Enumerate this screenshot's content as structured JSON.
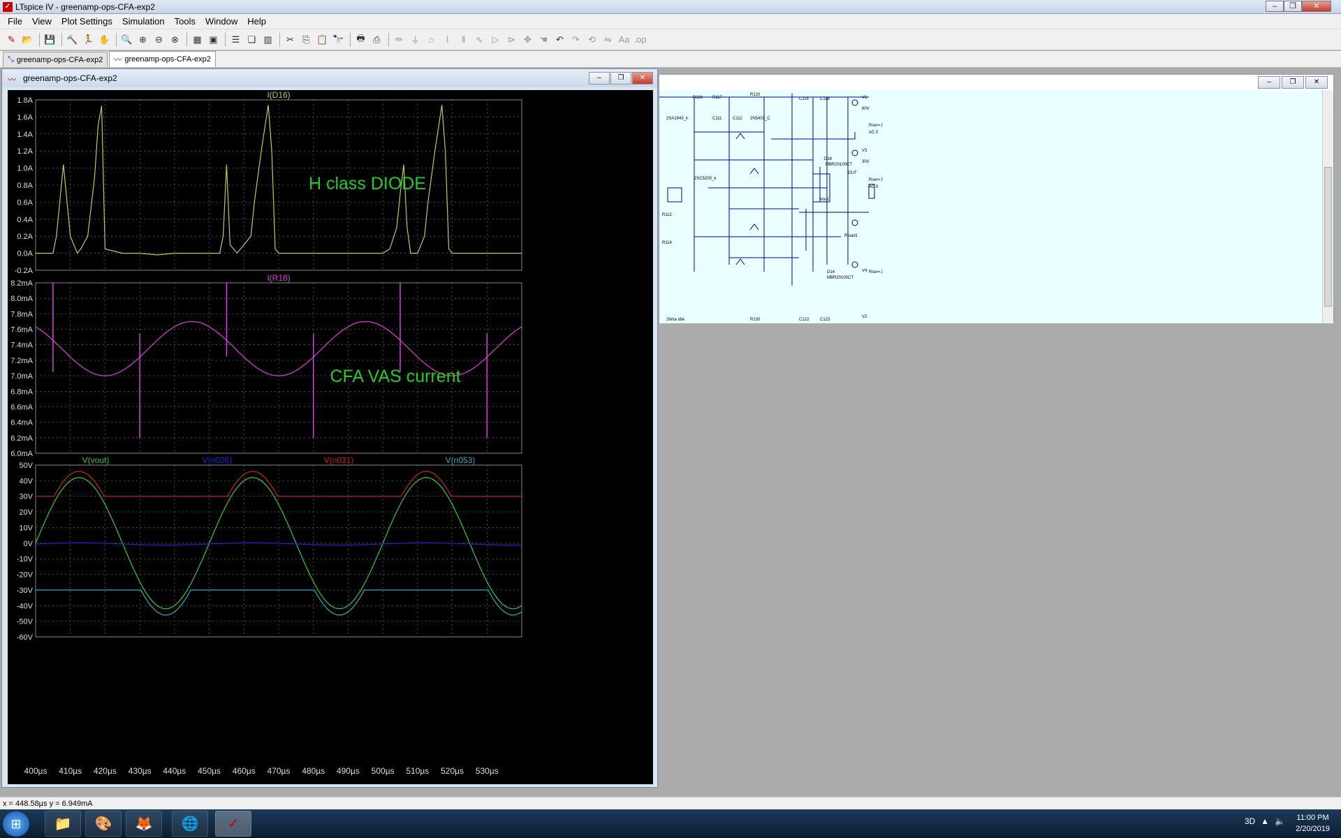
{
  "app": {
    "title": "LTspice IV - greenamp-ops-CFA-exp2"
  },
  "menu": [
    "File",
    "View",
    "Plot Settings",
    "Simulation",
    "Tools",
    "Window",
    "Help"
  ],
  "tabs": [
    {
      "label": "greenamp-ops-CFA-exp2",
      "icon": "schematic-icon"
    },
    {
      "label": "greenamp-ops-CFA-exp2",
      "icon": "waveform-icon"
    }
  ],
  "plot_window": {
    "title": "greenamp-ops-CFA-exp2"
  },
  "status": {
    "coords": "x = 448.58µs   y = 6.949mA"
  },
  "clock": {
    "time": "11:00 PM",
    "date": "2/20/2019"
  },
  "colors": {
    "yellow": "#c8c850",
    "magenta": "#e03ce0",
    "green": "#33cc33",
    "red": "#d02020",
    "blue": "#2222dd",
    "cyan": "#2ab0c0",
    "annotation": "#22cc22"
  },
  "x_ticks": [
    "400µs",
    "410µs",
    "420µs",
    "430µs",
    "440µs",
    "450µs",
    "460µs",
    "470µs",
    "480µs",
    "490µs",
    "500µs",
    "510µs",
    "520µs",
    "530µs"
  ],
  "chart_data": [
    {
      "type": "line",
      "series": [
        {
          "name": "I(D16)",
          "color_key": "yellow",
          "x": [
            400,
            405,
            406,
            408,
            410,
            412,
            413,
            415,
            417,
            418,
            419,
            420,
            425,
            430,
            435,
            440,
            445,
            450,
            452,
            453,
            454,
            455,
            456,
            458,
            460,
            462,
            463,
            465,
            467,
            468,
            469,
            470,
            475,
            480,
            485,
            490,
            495,
            500,
            502,
            504,
            505,
            506,
            507,
            508,
            510,
            512,
            513,
            515,
            517,
            518,
            519,
            520,
            530,
            540
          ],
          "y": [
            0,
            0,
            0.2,
            1.04,
            0.2,
            0,
            0.05,
            0.2,
            0.9,
            1.5,
            1.73,
            0.05,
            0,
            0,
            -0.02,
            0,
            0,
            0,
            0,
            0,
            0.2,
            1.04,
            0.1,
            0,
            0.1,
            0.2,
            0.6,
            1.2,
            1.74,
            1.2,
            0.05,
            0,
            0,
            0,
            0,
            0,
            0,
            0,
            0.05,
            0.3,
            0.7,
            1.04,
            0.3,
            0,
            0,
            0.2,
            0.6,
            1.2,
            1.74,
            1.2,
            0.05,
            0,
            0,
            0
          ]
        }
      ],
      "annotations": [
        "H class DIODE"
      ],
      "x_range": [
        400,
        540
      ],
      "y_range": [
        -0.2,
        1.8
      ],
      "y_ticks": [
        "1.8A",
        "1.6A",
        "1.4A",
        "1.2A",
        "1.0A",
        "0.8A",
        "0.6A",
        "0.4A",
        "0.2A",
        "0.0A",
        "-0.2A"
      ],
      "grid": true
    },
    {
      "type": "line",
      "series": [
        {
          "name": "I(R18)",
          "color_key": "magenta",
          "sine": {
            "offset": 7.35,
            "amplitude": 0.35,
            "period_us": 50,
            "phase_at_400": 0.35
          },
          "spikes": [
            {
              "x": 405,
              "top": 8.2,
              "bottom": 7.05
            },
            {
              "x": 430,
              "top": 7.55,
              "bottom": 6.2
            },
            {
              "x": 455,
              "top": 8.2,
              "bottom": 7.25
            },
            {
              "x": 480,
              "top": 7.55,
              "bottom": 6.2
            },
            {
              "x": 505,
              "top": 8.2,
              "bottom": 7.05
            },
            {
              "x": 530,
              "top": 7.55,
              "bottom": 6.2
            }
          ]
        }
      ],
      "annotations": [
        "CFA VAS current"
      ],
      "x_range": [
        400,
        540
      ],
      "y_range": [
        6.0,
        8.2
      ],
      "y_ticks": [
        "8.2mA",
        "8.0mA",
        "7.8mA",
        "7.6mA",
        "7.4mA",
        "7.2mA",
        "7.0mA",
        "6.8mA",
        "6.6mA",
        "6.4mA",
        "6.2mA",
        "6.0mA"
      ],
      "grid": true
    },
    {
      "type": "line",
      "series": [
        {
          "name": "V(vout)",
          "color_key": "green",
          "sine": {
            "offset": 0,
            "amplitude": 42,
            "period_us": 50,
            "phase_at_400": 0
          }
        },
        {
          "name": "V(n026)",
          "color_key": "blue",
          "sine": {
            "offset": -0.5,
            "amplitude": 0.7,
            "period_us": 50,
            "phase_at_400": 0
          }
        },
        {
          "name": "V(n031)",
          "color_key": "red",
          "sine": {
            "offset": 4,
            "amplitude": 42,
            "period_us": 50,
            "phase_at_400": 0
          },
          "floor": 30
        },
        {
          "name": "V(n053)",
          "color_key": "cyan",
          "sine": {
            "offset": -4,
            "amplitude": 42,
            "period_us": 50,
            "phase_at_400": 0
          },
          "ceiling": -30
        }
      ],
      "x_range": [
        400,
        540
      ],
      "y_range": [
        -60,
        50
      ],
      "y_ticks": [
        "50V",
        "40V",
        "30V",
        "20V",
        "10V",
        "0V",
        "-10V",
        "-20V",
        "-30V",
        "-40V",
        "-50V",
        "-60V"
      ],
      "grid": true
    }
  ]
}
